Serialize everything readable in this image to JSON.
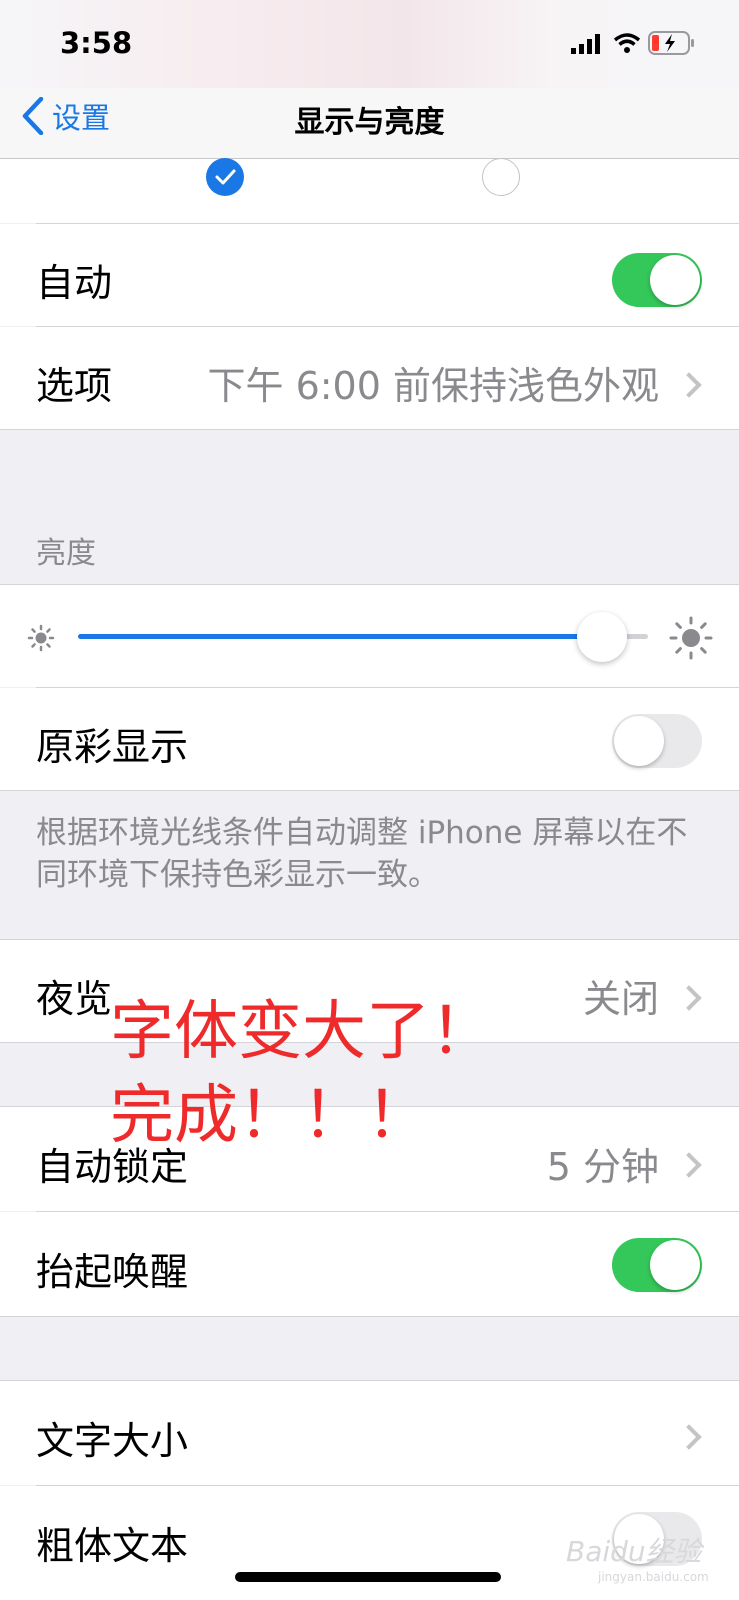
{
  "status_bar": {
    "time": "3:58"
  },
  "nav": {
    "back_label": "设置",
    "title": "显示与亮度"
  },
  "appearance": {
    "light_selected": true,
    "dark_selected": false
  },
  "automatic": {
    "label": "自动",
    "on": true
  },
  "options": {
    "label": "选项",
    "value": "下午 6:00 前保持浅色外观"
  },
  "brightness": {
    "header": "亮度",
    "level": 0.96
  },
  "true_tone": {
    "label": "原彩显示",
    "on": false,
    "footer": "根据环境光线条件自动调整 iPhone 屏幕以在不同环境下保持色彩显示一致。"
  },
  "night_shift": {
    "label": "夜览",
    "value": "关闭"
  },
  "annotation": {
    "line1": "字体变大了！",
    "line2": "完成！！！",
    "color": "#ee2a2a"
  },
  "auto_lock": {
    "label": "自动锁定",
    "value": "5 分钟"
  },
  "raise_to_wake": {
    "label": "抬起唤醒",
    "on": true
  },
  "text_size": {
    "label": "文字大小"
  },
  "bold_text": {
    "label": "粗体文本",
    "on": false
  },
  "watermark": {
    "text": "Baidu经验",
    "sub": "jingyan.baidu.com"
  },
  "colors": {
    "accent": "#1a78e6",
    "toggle_on": "#34c759"
  }
}
